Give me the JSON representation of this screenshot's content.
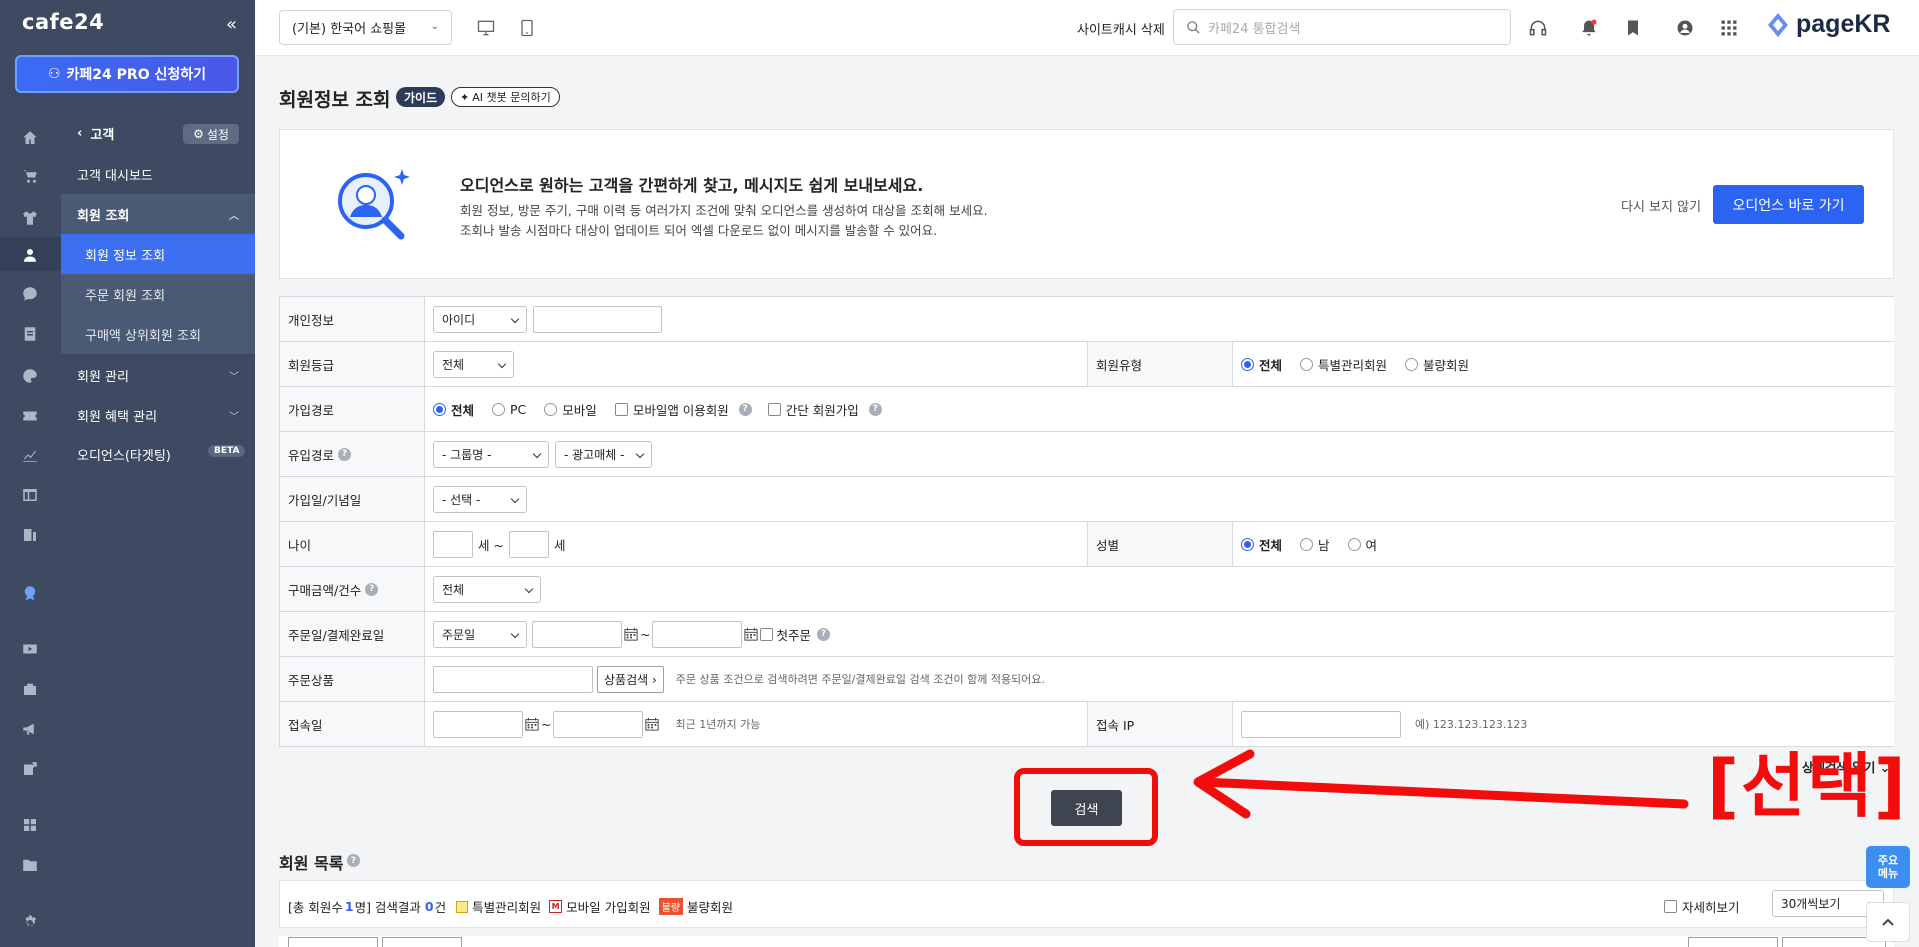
{
  "brand": {
    "logo": "cafe24",
    "collapse": "«",
    "pro_button": "카페24 PRO 신청하기"
  },
  "rail_icons": [
    "home-icon",
    "cart-icon",
    "shirt-icon",
    "user-icon",
    "chat-icon",
    "document-icon",
    "palette-icon",
    "coupon-icon",
    "chart-icon",
    "table-icon",
    "app-icon",
    "badge-icon",
    "video-icon",
    "store-icon",
    "megaphone-icon",
    "export-icon",
    "widgets-icon",
    "folder-icon",
    "settings-icon"
  ],
  "sidebar": {
    "back_label": "고객",
    "settings_label": "설정",
    "items": [
      {
        "label": "고객 대시보드"
      },
      {
        "label": "회원 조회"
      },
      {
        "label": "회원 정보 조회"
      },
      {
        "label": "주문 회원 조회"
      },
      {
        "label": "구매액 상위회원 조회"
      },
      {
        "label": "회원 관리"
      },
      {
        "label": "회원 혜택 관리"
      },
      {
        "label": "오디언스(타겟팅)"
      }
    ],
    "beta": "BETA"
  },
  "topbar": {
    "mall_select": "(기본) 한국어 쇼핑몰",
    "cache_link": "사이트캐시 삭제",
    "search_placeholder": "카페24 통합검색",
    "brand": "pageKR"
  },
  "page": {
    "title": "회원정보 조회",
    "guide": "가이드",
    "ai_chat": "AI 챗봇 문의하기"
  },
  "banner": {
    "title": "오디언스로 원하는 고객을 간편하게 찾고, 메시지도 쉽게 보내보세요.",
    "desc1": "회원 정보, 방문 주기, 구매 이력 등 여러가지 조건에 맞춰 오디언스를 생성하여 대상을 조회해 보세요.",
    "desc2": "조회나 발송 시점마다 대상이 업데이트 되어 엑셀 다운로드 없이 메시지를 발송할 수 있어요.",
    "no_show": "다시 보지 않기",
    "button": "오디언스 바로 가기"
  },
  "form": {
    "personal": {
      "label": "개인정보",
      "select": "아이디"
    },
    "grade": {
      "label": "회원등급",
      "select": "전체"
    },
    "member_type": {
      "label": "회원유형",
      "options": [
        "전체",
        "특별관리회원",
        "불량회원"
      ]
    },
    "join_path": {
      "label": "가입경로",
      "options": [
        "전체",
        "PC",
        "모바일"
      ],
      "check1": "모바일앱 이용회원",
      "check2": "간단 회원가입"
    },
    "inflow": {
      "label": "유입경로",
      "select1": "- 그룹명 -",
      "select2": "- 광고매체 -"
    },
    "join_date": {
      "label": "가입일/기념일",
      "select": "- 선택 -"
    },
    "age": {
      "label": "나이",
      "unit1": "세 ~",
      "unit2": "세"
    },
    "gender": {
      "label": "성별",
      "options": [
        "전체",
        "남",
        "여"
      ]
    },
    "purchase": {
      "label": "구매금액/건수",
      "select": "전체"
    },
    "order_date": {
      "label": "주문일/결제완료일",
      "select": "주문일",
      "tilde": "~",
      "first_order": "첫주문"
    },
    "order_product": {
      "label": "주문상품",
      "button": "상품검색 ›",
      "hint": "주문 상품 조건으로 검색하려면 주문일/결제완료일 검색 조건이 함께 적용되어요."
    },
    "access_date": {
      "label": "접속일",
      "tilde": "~",
      "hint": "최근 1년까지 가능"
    },
    "access_ip": {
      "label": "접속 IP",
      "hint": "예) 123.123.123.123"
    },
    "detail_link": "상세검색 열기 ⌄",
    "search_button": "검색"
  },
  "annotation": {
    "label": "[선택]"
  },
  "list": {
    "title": "회원 목록",
    "summary_prefix": "[총 회원수",
    "total": "1",
    "summary_mid": "명] 검색결과",
    "result": "0",
    "summary_suffix": "건",
    "legend_special": "특별관리회원",
    "legend_mobile_mark": "M",
    "legend_mobile": "모바일 가입회원",
    "legend_bad_mark": "불량",
    "legend_bad": "불량회원",
    "detail_view": "자세히보기",
    "per_page": "30개씩보기"
  },
  "quick_menu": {
    "line1": "주요",
    "line2": "메뉴"
  },
  "colors": {
    "sidebar": "#3d4a61",
    "active": "#3c70f0",
    "primary": "#2b63f2",
    "annotation": "#f20c0c"
  }
}
